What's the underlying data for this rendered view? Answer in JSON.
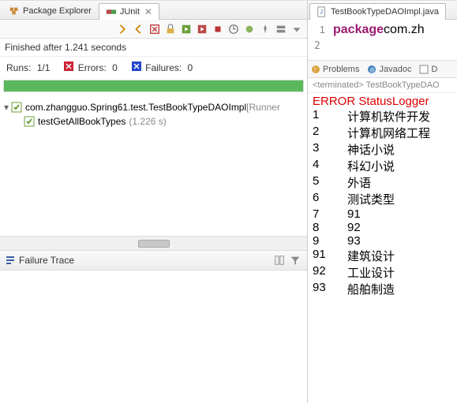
{
  "left": {
    "tabs": [
      {
        "label": "Package Explorer",
        "active": false
      },
      {
        "label": "JUnit",
        "active": true
      }
    ],
    "status": "Finished after 1.241 seconds",
    "stats": {
      "runs_label": "Runs:",
      "runs_value": "1/1",
      "errors_label": "Errors:",
      "errors_value": "0",
      "failures_label": "Failures:",
      "failures_value": "0"
    },
    "tree": {
      "root_label": "com.zhangguo.Spring61.test.TestBookTypeDAOImpl",
      "root_runner": " [Runner",
      "child_label": "testGetAllBookTypes",
      "child_time": "(1.226 s)"
    },
    "failure_trace_label": "Failure Trace"
  },
  "right": {
    "editor_tab": "TestBookTypeDAOImpl.java",
    "code": {
      "lineno": "1",
      "keyword": "package",
      "rest": " com.zh"
    },
    "lineno2": "2",
    "console_tabs": {
      "problems": "Problems",
      "javadoc": "Javadoc",
      "decl": "D"
    },
    "terminated": "<terminated> TestBookTypeDAO",
    "error_line": "ERROR StatusLogger",
    "rows": [
      {
        "n": "1",
        "t": "计算机软件开发"
      },
      {
        "n": "2",
        "t": "计算机网络工程"
      },
      {
        "n": "3",
        "t": "神话小说"
      },
      {
        "n": "4",
        "t": "科幻小说"
      },
      {
        "n": "5",
        "t": "外语"
      },
      {
        "n": "6",
        "t": "测试类型"
      },
      {
        "n": "7",
        "t": "91"
      },
      {
        "n": "8",
        "t": "92"
      },
      {
        "n": "9",
        "t": "93"
      },
      {
        "n": "91",
        "t": "建筑设计"
      },
      {
        "n": "92",
        "t": "工业设计"
      },
      {
        "n": "93",
        "t": "船舶制造"
      }
    ]
  }
}
